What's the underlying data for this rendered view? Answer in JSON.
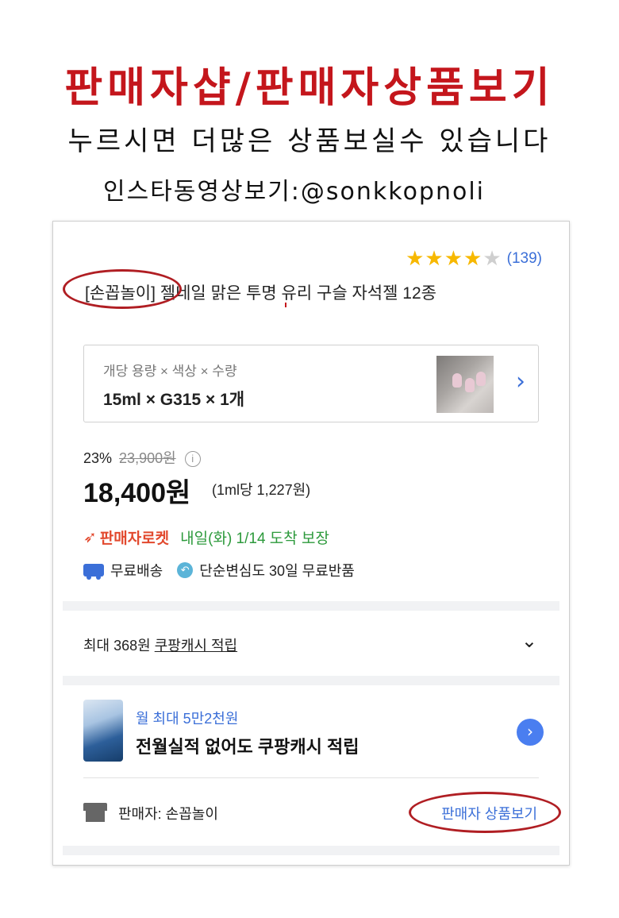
{
  "header": {
    "title": "판매자샵/판매자상품보기",
    "subtitle": "누르시면 더많은 상품보실수 있습니다",
    "instagram": "인스타동영상보기:@sonkkopnoli"
  },
  "product": {
    "rating_stars": "★★★★",
    "rating_half": "★",
    "rating_value": 4.5,
    "review_count": "(139)",
    "title": "[손꼽놀이] 젤네일 맑은 투명 유리 구슬 자석젤 12종",
    "option": {
      "label": "개당 용량 × 색상 × 수량",
      "value": "15ml × G315 × 1개",
      "chevron_icon": "chevron-right-icon"
    },
    "discount_rate": "23%",
    "original_price": "23,900원",
    "price": "18,400원",
    "unit_price": "(1ml당 1,227원)",
    "delivery": {
      "rocket_icon": "rocket-icon",
      "rocket_label": "판매자로켓",
      "arrival": "내일(화) 1/14 도착 보장"
    },
    "perks": {
      "free_shipping": "무료배송",
      "free_return": "단순변심도 30일 무료반품"
    }
  },
  "cash": {
    "prefix": "최대 368원 ",
    "link": "쿠팡캐시 적립"
  },
  "promo": {
    "line1": "월 최대 5만2천원",
    "line2": "전월실적 없어도 쿠팡캐시 적립"
  },
  "seller": {
    "name": "판매자: 손꼽놀이",
    "link": "판매자 상품보기"
  },
  "colors": {
    "accent_red": "#c4161c",
    "link_blue": "#3b6fd8",
    "arrival_green": "#2d9a3c",
    "star_yellow": "#f7b800"
  }
}
